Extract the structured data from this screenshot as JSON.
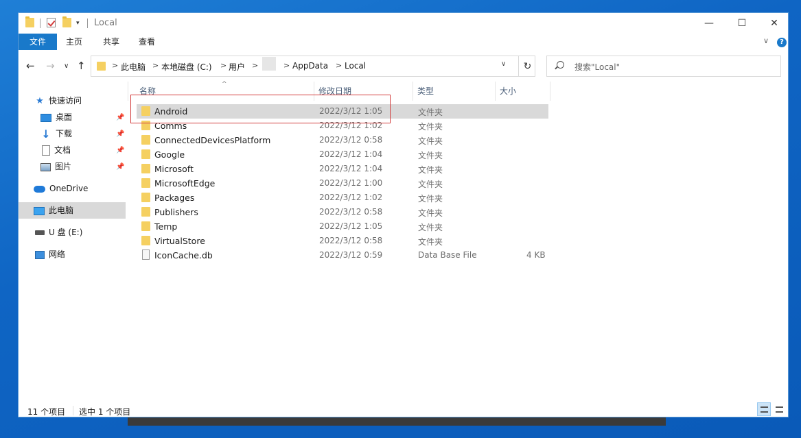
{
  "window": {
    "title": "Local",
    "minimize": "—",
    "maximize": "☐",
    "close": "✕"
  },
  "ribbon": {
    "tabs": [
      "文件",
      "主页",
      "共享",
      "查看"
    ],
    "expand_glyph": "∨",
    "help_glyph": "?"
  },
  "address_bar": {
    "breadcrumbs": [
      "此电脑",
      "本地磁盘 (C:)",
      "用户",
      "",
      "AppData",
      "Local"
    ],
    "separator": ">",
    "dropdown_glyph": "∨",
    "refresh_glyph": "↻"
  },
  "search": {
    "placeholder": "搜索\"Local\""
  },
  "nav_pane": {
    "quick_access": "快速访问",
    "desktop": "桌面",
    "downloads": "下载",
    "documents": "文档",
    "pictures": "图片",
    "onedrive": "OneDrive",
    "this_pc": "此电脑",
    "usb_drive": "U 盘 (E:)",
    "network": "网络",
    "pin_glyph": "📌"
  },
  "columns": {
    "name": "名称",
    "modified": "修改日期",
    "type": "类型",
    "size": "大小"
  },
  "files": [
    {
      "name": "Android",
      "modified": "2022/3/12 1:05",
      "type": "文件夹",
      "size": "",
      "kind": "folder",
      "selected": true
    },
    {
      "name": "Comms",
      "modified": "2022/3/12 1:02",
      "type": "文件夹",
      "size": "",
      "kind": "folder"
    },
    {
      "name": "ConnectedDevicesPlatform",
      "modified": "2022/3/12 0:58",
      "type": "文件夹",
      "size": "",
      "kind": "folder"
    },
    {
      "name": "Google",
      "modified": "2022/3/12 1:04",
      "type": "文件夹",
      "size": "",
      "kind": "folder"
    },
    {
      "name": "Microsoft",
      "modified": "2022/3/12 1:04",
      "type": "文件夹",
      "size": "",
      "kind": "folder"
    },
    {
      "name": "MicrosoftEdge",
      "modified": "2022/3/12 1:00",
      "type": "文件夹",
      "size": "",
      "kind": "folder"
    },
    {
      "name": "Packages",
      "modified": "2022/3/12 1:02",
      "type": "文件夹",
      "size": "",
      "kind": "folder"
    },
    {
      "name": "Publishers",
      "modified": "2022/3/12 0:58",
      "type": "文件夹",
      "size": "",
      "kind": "folder"
    },
    {
      "name": "Temp",
      "modified": "2022/3/12 1:05",
      "type": "文件夹",
      "size": "",
      "kind": "folder"
    },
    {
      "name": "VirtualStore",
      "modified": "2022/3/12 0:58",
      "type": "文件夹",
      "size": "",
      "kind": "folder"
    },
    {
      "name": "IconCache.db",
      "modified": "2022/3/12 0:59",
      "type": "Data Base File",
      "size": "4 KB",
      "kind": "file"
    }
  ],
  "status_bar": {
    "item_count": "11 个项目",
    "selected_count": "选中 1 个项目"
  },
  "colors": {
    "accent": "#1979ca",
    "selection": "#d9d9d9",
    "highlight_box": "#d23b3b",
    "folder": "#f5d061"
  }
}
